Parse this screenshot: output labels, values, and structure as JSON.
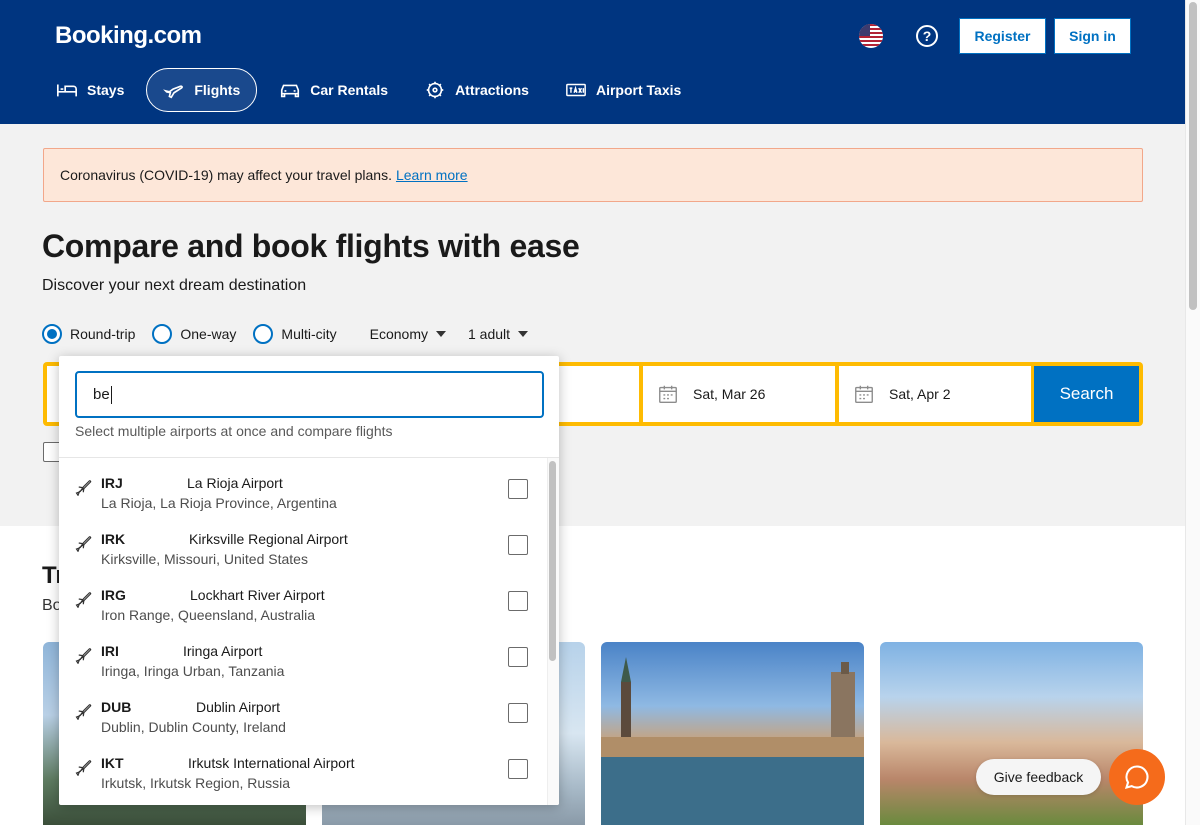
{
  "header": {
    "logo": "Booking.com",
    "help_symbol": "?",
    "register_label": "Register",
    "signin_label": "Sign in",
    "flag_icon": "us-flag-icon",
    "colors": {
      "header_bg": "#003580",
      "accent": "#0071c2",
      "search_border": "#febb02"
    }
  },
  "nav": {
    "items": [
      {
        "label": "Stays",
        "icon": "bed-icon",
        "active": false
      },
      {
        "label": "Flights",
        "icon": "plane-icon",
        "active": true
      },
      {
        "label": "Car Rentals",
        "icon": "car-icon",
        "active": false
      },
      {
        "label": "Attractions",
        "icon": "attractions-icon",
        "active": false
      },
      {
        "label": "Airport Taxis",
        "icon": "taxi-icon",
        "active": false
      }
    ]
  },
  "banner": {
    "text": "Coronavirus (COVID-19) may affect your travel plans.",
    "link": "Learn more"
  },
  "hero": {
    "title": "Compare and book flights with ease",
    "subtitle": "Discover your next dream destination"
  },
  "trip_options": {
    "types": [
      "Round-trip",
      "One-way",
      "Multi-city"
    ],
    "selected": "Round-trip",
    "cabin": "Economy",
    "travelers": "1 adult"
  },
  "search": {
    "depart_date": "Sat, Mar 26",
    "return_date": "Sat, Apr 2",
    "button_label": "Search"
  },
  "dropdown": {
    "input_value": "be",
    "hint": "Select multiple airports at once and compare flights",
    "airports": [
      {
        "code": "IRJ",
        "name": "La Rioja Airport",
        "location": "La Rioja, La Rioja Province, Argentina"
      },
      {
        "code": "IRK",
        "name": "Kirksville Regional Airport",
        "location": "Kirksville, Missouri, United States"
      },
      {
        "code": "IRG",
        "name": "Lockhart River Airport",
        "location": "Iron Range, Queensland, Australia"
      },
      {
        "code": "IRI",
        "name": "Iringa Airport",
        "location": "Iringa, Iringa Urban, Tanzania"
      },
      {
        "code": "DUB",
        "name": "Dublin Airport",
        "location": "Dublin, Dublin County, Ireland"
      },
      {
        "code": "IKT",
        "name": "Irkutsk International Airport",
        "location": "Irkutsk, Irkutsk Region, Russia"
      }
    ]
  },
  "trending": {
    "title_fragment": "Tr",
    "subtitle_fragment": "Bo"
  },
  "feedback": {
    "label": "Give feedback"
  }
}
